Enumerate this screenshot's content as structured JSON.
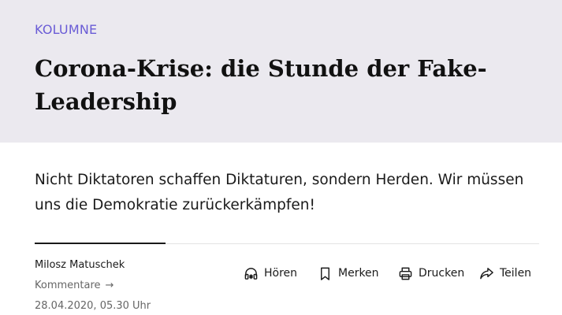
{
  "article": {
    "kicker": "KOLUMNE",
    "headline": "Corona-Krise: die Stunde der Fake-Leadership",
    "lead": "Nicht Diktatoren schaffen Diktaturen, sondern Herden. Wir müssen uns die Demokratie zurückerkämpfen!"
  },
  "meta": {
    "author": "Milosz Matuschek",
    "comments_label": "Kommentare",
    "comments_arrow": "→",
    "date": "28.04.2020, 05.30 Uhr"
  },
  "actions": {
    "listen": {
      "label": "Hören",
      "icon": "headphones-icon"
    },
    "bookmark": {
      "label": "Merken",
      "icon": "bookmark-icon"
    },
    "print": {
      "label": "Drucken",
      "icon": "printer-icon"
    },
    "share": {
      "label": "Teilen",
      "icon": "share-arrow-icon"
    }
  },
  "colors": {
    "kicker": "#6a5cd6",
    "header_background": "#ebe9ef"
  }
}
